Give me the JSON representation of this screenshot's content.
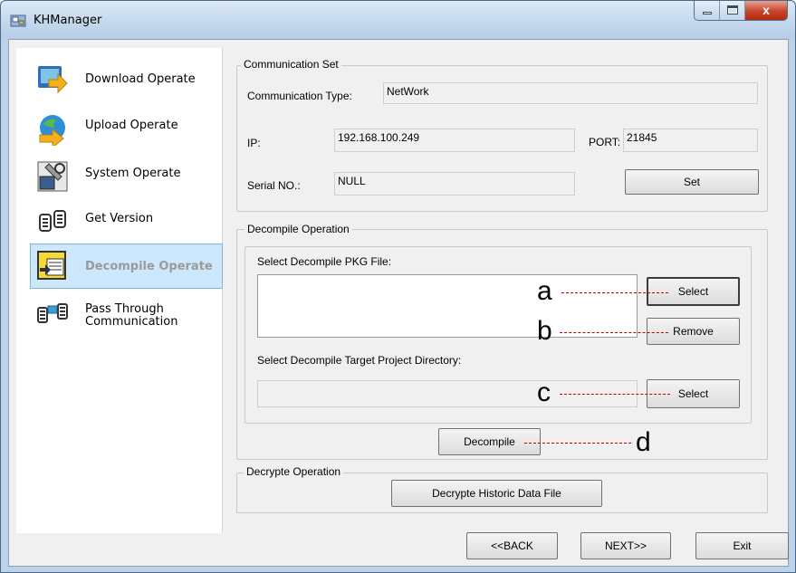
{
  "window": {
    "title": "KHManager",
    "close_glyph": "x"
  },
  "sidebar": {
    "items": [
      {
        "label": "Download Operate",
        "icon": "download-icon"
      },
      {
        "label": "Upload Operate",
        "icon": "upload-icon"
      },
      {
        "label": "System Operate",
        "icon": "system-icon"
      },
      {
        "label": "Get Version",
        "icon": "version-icon"
      },
      {
        "label": "Decompile Operate",
        "icon": "decompile-icon",
        "active": true
      },
      {
        "label": "Pass Through",
        "label2": "Communication",
        "icon": "passthrough-icon"
      }
    ]
  },
  "communication": {
    "title": "Communication Set",
    "type_label": "Communication Type:",
    "type_value": "NetWork",
    "ip_label": "IP:",
    "ip_value": "192.168.100.249",
    "port_label": "PORT:",
    "port_value": "21845",
    "serial_label": "Serial NO.:",
    "serial_value": "NULL",
    "set_button": "Set"
  },
  "decompile": {
    "title": "Decompile Operation",
    "pkg_label": "Select Decompile PKG File:",
    "select_button": "Select",
    "remove_button": "Remove",
    "target_label": "Select Decompile Target Project Directory:",
    "select_dir_button": "Select",
    "decompile_button": "Decompile"
  },
  "decrypt": {
    "title": "Decrypte Operation",
    "button": "Decrypte Historic Data File"
  },
  "footer": {
    "back": "<<BACK",
    "next": "NEXT>>",
    "exit": "Exit"
  },
  "annotations": {
    "a": "a",
    "b": "b",
    "c": "c",
    "d": "d"
  },
  "colors": {
    "annotation_line": "#c00000",
    "active_item_bg": "#cde8fc"
  }
}
